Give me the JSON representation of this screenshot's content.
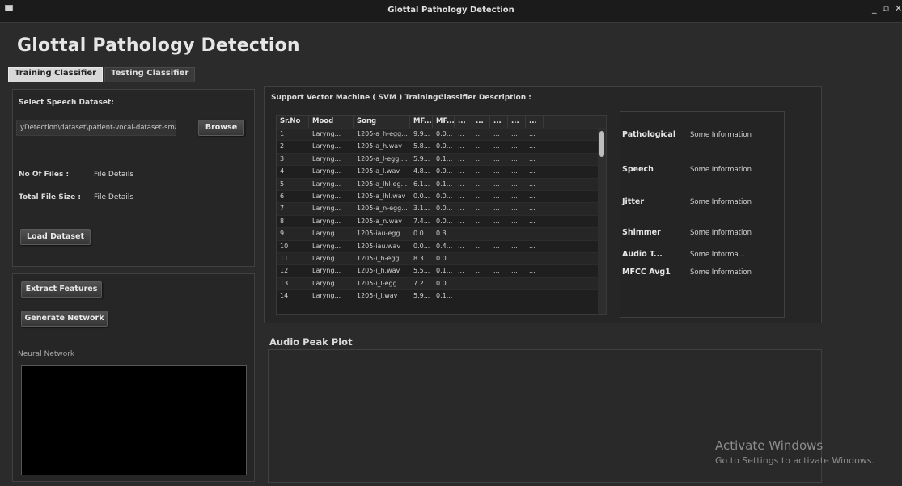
{
  "window": {
    "title": "Glottal Pathology Detection",
    "controls": [
      "_",
      "⧉",
      "✕"
    ]
  },
  "heading": "Glottal Pathology Detection",
  "tabs": [
    "Training Classifier",
    "Testing Classifier"
  ],
  "left": {
    "select_label": "Select Speech Dataset:",
    "dataset_path": "yDetection\\dataset\\patient-vocal-dataset-small",
    "browse": "Browse",
    "no_files_label": "No Of Files :",
    "no_files_value": "File Details",
    "size_label": "Total File Size :",
    "size_value": "File Details",
    "load": "Load Dataset",
    "extract": "Extract Features",
    "generate": "Generate Network",
    "nn_label": "Neural Network"
  },
  "svm": {
    "title": "Support Vector Machine ( SVM ) Training :",
    "desc_title": "Classifier Description :",
    "columns": [
      "Sr.No",
      "Mood",
      "Song",
      "MF...",
      "MF...",
      "...",
      "...",
      "...",
      "...",
      "..."
    ],
    "rows": [
      [
        "1",
        "Laryng...",
        "1205-a_h-egg...",
        "9.9...",
        "0.0...",
        "...",
        "...",
        "...",
        "...",
        "..."
      ],
      [
        "2",
        "Laryng...",
        "1205-a_h.wav",
        "5.8...",
        "0.0...",
        "...",
        "...",
        "...",
        "...",
        "..."
      ],
      [
        "3",
        "Laryng...",
        "1205-a_l-egg....",
        "5.9...",
        "0.1...",
        "...",
        "...",
        "...",
        "...",
        "..."
      ],
      [
        "4",
        "Laryng...",
        "1205-a_l.wav",
        "4.8...",
        "0.0...",
        "...",
        "...",
        "...",
        "...",
        "..."
      ],
      [
        "5",
        "Laryng...",
        "1205-a_lhl-eg...",
        "6.1...",
        "0.1...",
        "...",
        "...",
        "...",
        "...",
        "..."
      ],
      [
        "6",
        "Laryng...",
        "1205-a_lhl.wav",
        "0.0...",
        "0.0...",
        "...",
        "...",
        "...",
        "...",
        "..."
      ],
      [
        "7",
        "Laryng...",
        "1205-a_n-egg...",
        "3.1...",
        "0.0...",
        "...",
        "...",
        "...",
        "...",
        "..."
      ],
      [
        "8",
        "Laryng...",
        "1205-a_n.wav",
        "7.4...",
        "0.0...",
        "...",
        "...",
        "...",
        "...",
        "..."
      ],
      [
        "9",
        "Laryng...",
        "1205-iau-egg....",
        "0.0...",
        "0.3...",
        "...",
        "...",
        "...",
        "...",
        "..."
      ],
      [
        "10",
        "Laryng...",
        "1205-iau.wav",
        "0.0...",
        "0.4...",
        "...",
        "...",
        "...",
        "...",
        "..."
      ],
      [
        "11",
        "Laryng...",
        "1205-i_h-egg....",
        "8.3...",
        "0.0...",
        "...",
        "...",
        "...",
        "...",
        "..."
      ],
      [
        "12",
        "Laryng...",
        "1205-i_h.wav",
        "5.5...",
        "0.1...",
        "...",
        "...",
        "...",
        "...",
        "..."
      ],
      [
        "13",
        "Laryng...",
        "1205-i_l-egg....",
        "7.2...",
        "0.0...",
        "...",
        "...",
        "...",
        "...",
        "..."
      ],
      [
        "14",
        "Laryng...",
        "1205-i_l.wav",
        "5.9...",
        "0.1...",
        "",
        "",
        "",
        "",
        ""
      ]
    ]
  },
  "info": [
    {
      "label": "Pathological",
      "value": "Some Information"
    },
    {
      "label": "Speech",
      "value": "Some Information"
    },
    {
      "label": "Jitter",
      "value": "Some Information"
    },
    {
      "label": "Shimmer",
      "value": "Some Information"
    },
    {
      "label": "Audio T...",
      "value": "Some Informa..."
    },
    {
      "label": "MFCC Avg1",
      "value": "Some Information"
    }
  ],
  "plot_title": "Audio Peak Plot",
  "watermark": {
    "line1": "Activate Windows",
    "line2": "Go to Settings to activate Windows."
  }
}
